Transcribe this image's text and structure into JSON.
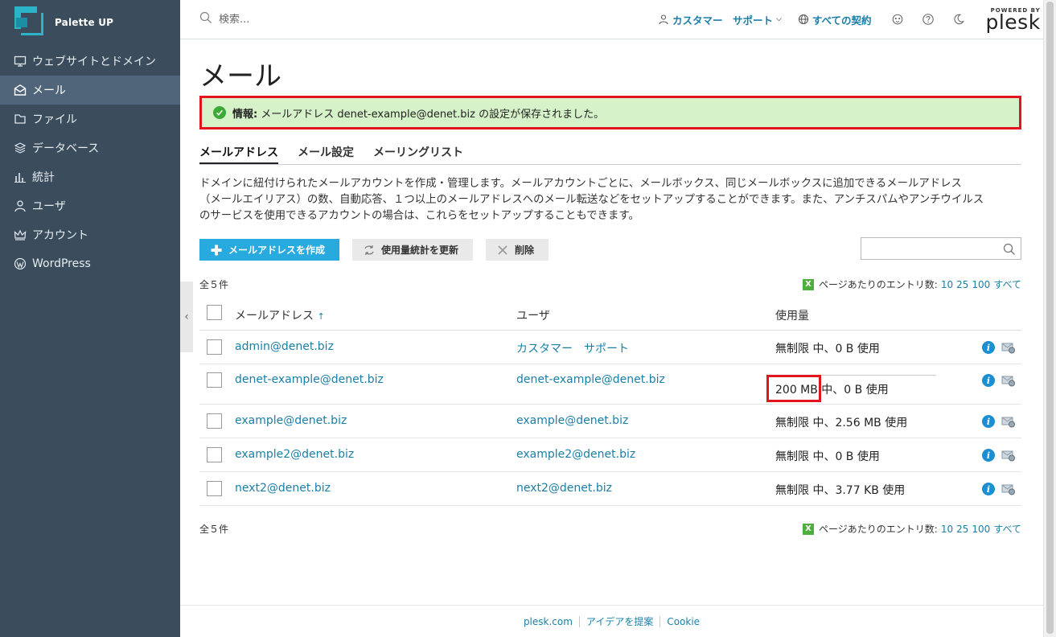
{
  "brand": {
    "name": "Palette UP"
  },
  "sidebar": {
    "items": [
      {
        "label": "ウェブサイトとドメイン",
        "icon": "monitor-icon",
        "active": false
      },
      {
        "label": "メール",
        "icon": "mail-icon",
        "active": true
      },
      {
        "label": "ファイル",
        "icon": "folder-icon",
        "active": false
      },
      {
        "label": "データベース",
        "icon": "database-icon",
        "active": false
      },
      {
        "label": "統計",
        "icon": "stats-icon",
        "active": false
      },
      {
        "label": "ユーザ",
        "icon": "user-icon",
        "active": false
      },
      {
        "label": "アカウント",
        "icon": "crown-icon",
        "active": false
      },
      {
        "label": "WordPress",
        "icon": "wordpress-icon",
        "active": false
      }
    ]
  },
  "topbar": {
    "search_placeholder": "検索...",
    "customer": "カスタマー　サポート",
    "subscriptions": "すべての契約",
    "logo_powered": "POWERED BY",
    "logo_word": "plesk"
  },
  "page": {
    "title": "メール",
    "alert_label": "情報:",
    "alert_text": "メールアドレス denet-example@denet.biz の設定が保存されました。",
    "tabs": [
      {
        "label": "メールアドレス",
        "active": true
      },
      {
        "label": "メール設定",
        "active": false
      },
      {
        "label": "メーリングリスト",
        "active": false
      }
    ],
    "description_lines": [
      "ドメインに紐付けられたメールアカウントを作成・管理します。メールアカウントごとに、メールボックス、同じメールボックスに追加できるメールアドレス",
      "（メールエイリアス）の数、自動応答、１つ以上のメールアドレスへのメール転送などをセットアップすることができます。また、アンチスパムやアンチウイルス",
      "のサービスを使用できるアカウントの場合は、これらをセットアップすることもできます。"
    ]
  },
  "toolbar": {
    "create_label": "メールアドレスを作成",
    "update_stats_label": "使用量統計を更新",
    "delete_label": "削除"
  },
  "list": {
    "total": "全５件",
    "per_page_label": "ページあたりのエントリ数:",
    "per_page_options": [
      "10",
      "25",
      "100",
      "すべて"
    ],
    "columns": {
      "email": "メールアドレス",
      "user": "ユーザ",
      "usage": "使用量"
    },
    "rows": [
      {
        "email": "admin@denet.biz",
        "user": "カスタマー　サポート",
        "quota": "無制限",
        "usage": " 中、0 B 使用"
      },
      {
        "email": "denet-example@denet.biz",
        "user": "denet-example@denet.biz",
        "quota": "200 MB",
        "usage": " 中、0 B 使用"
      },
      {
        "email": "example@denet.biz",
        "user": "example@denet.biz",
        "quota": "無制限",
        "usage": " 中、2.56 MB 使用"
      },
      {
        "email": "example2@denet.biz",
        "user": "example2@denet.biz",
        "quota": "無制限",
        "usage": " 中、0 B 使用"
      },
      {
        "email": "next2@denet.biz",
        "user": "next2@denet.biz",
        "quota": "無制限",
        "usage": " 中、3.77 KB 使用"
      }
    ]
  },
  "footer": {
    "links": [
      "plesk.com",
      "アイデアを提案",
      "Cookie"
    ]
  },
  "colors": {
    "sidebar_bg": "#3b4d5c",
    "accent": "#28aade",
    "link": "#1a7fa8",
    "alert_bg": "#d6f2c9",
    "highlight": "#e2151f"
  }
}
